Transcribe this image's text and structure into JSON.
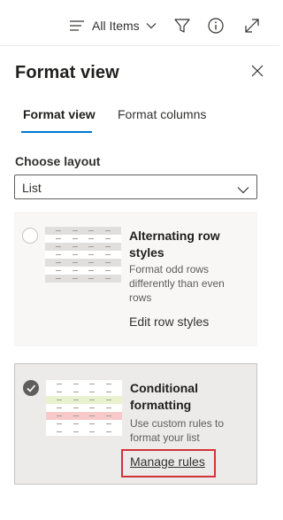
{
  "toolbar": {
    "view_label": "All Items",
    "icons": [
      "list-view-icon",
      "chevron-down-icon",
      "filter-icon",
      "info-icon",
      "expand-icon"
    ]
  },
  "panel": {
    "title": "Format view",
    "close_icon": "close-icon"
  },
  "tabs": [
    {
      "label": "Format view",
      "selected": true
    },
    {
      "label": "Format columns",
      "selected": false
    }
  ],
  "layout": {
    "label": "Choose layout",
    "selected": "List"
  },
  "options": [
    {
      "title": "Alternating row styles",
      "description": "Format odd rows differently than even rows",
      "link": "Edit row styles",
      "selected": false
    },
    {
      "title": "Conditional formatting",
      "description": "Use custom rules to format your list",
      "link": "Manage rules",
      "selected": true
    }
  ],
  "colors": {
    "accent": "#0078d4",
    "highlight_box": "#d13438",
    "row_green": "#e8f2cf",
    "row_red": "#f8c9c9",
    "row_gray": "#e1dfdd"
  }
}
